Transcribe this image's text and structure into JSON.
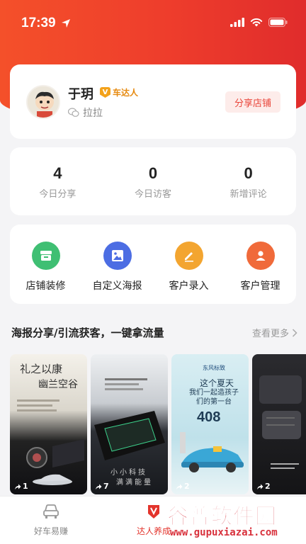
{
  "status_bar": {
    "time": "17:39"
  },
  "profile": {
    "name": "于玥",
    "badge_label": "车达人",
    "subtitle": "拉拉",
    "share_button": "分享店铺"
  },
  "stats": [
    {
      "value": "4",
      "label": "今日分享"
    },
    {
      "value": "0",
      "label": "今日访客"
    },
    {
      "value": "0",
      "label": "新增评论"
    }
  ],
  "tools": [
    {
      "label": "店铺装修",
      "color": "#3fbf73"
    },
    {
      "label": "自定义海报",
      "color": "#4c6de3"
    },
    {
      "label": "客户录入",
      "color": "#f3a530"
    },
    {
      "label": "客户管理",
      "color": "#f06a3a"
    }
  ],
  "section": {
    "title": "海报分享/引流获客，一键拿流量",
    "more": "查看更多"
  },
  "posters": [
    {
      "headline": "礼之以康",
      "sub": "幽兰空谷",
      "share_count": "1"
    },
    {
      "headline": "小小科技",
      "sub": "满满能量",
      "share_count": "7"
    },
    {
      "headline": "这个夏天",
      "sub": "我们一起造孩子们的第一台",
      "big": "408",
      "brand": "东风标致",
      "share_count": "2"
    },
    {
      "headline": "",
      "sub": "",
      "share_count": "2"
    }
  ],
  "tabs": [
    {
      "label": "好车易赚",
      "color": "#888888"
    },
    {
      "label": "达人养成",
      "color": "#e3342c"
    }
  ],
  "watermark": {
    "main": "谷普软件园",
    "url": "www.gupuxiazai.com"
  }
}
